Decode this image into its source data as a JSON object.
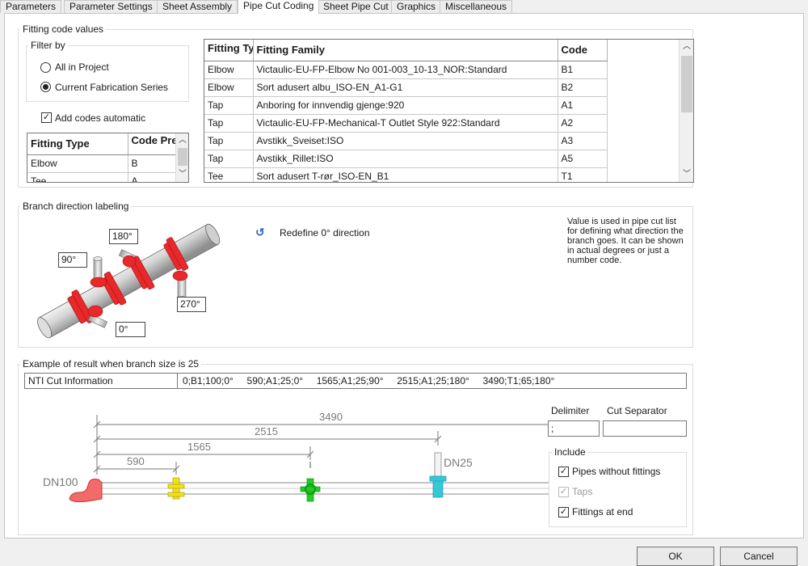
{
  "tabs": [
    "Parameters",
    "Parameter Settings",
    "Sheet Assembly",
    "Pipe Cut Coding",
    "Sheet Pipe Cut",
    "Graphics",
    "Miscellaneous"
  ],
  "active_tab": "Pipe Cut Coding",
  "fitting_codes": {
    "title": "Fitting code values",
    "filter": {
      "title": "Filter by",
      "options": [
        "All in Project",
        "Current Fabrication Series"
      ],
      "selected": "Current Fabrication Series"
    },
    "add_codes_label": "Add codes automatic",
    "add_codes_checked": true,
    "prefix_table": {
      "headers": [
        "Fitting Type",
        "Code Prefix"
      ],
      "rows": [
        [
          "Elbow",
          "B"
        ],
        [
          "Tee",
          "A"
        ]
      ]
    },
    "code_table": {
      "headers": [
        "Fitting Type",
        "Fitting Family",
        "Code"
      ],
      "rows": [
        [
          "Elbow",
          "Victaulic-EU-FP-Elbow No 001-003_10-13_NOR:Standard",
          "B1"
        ],
        [
          "Elbow",
          "Sort adusert albu_ISO-EN_A1-G1",
          "B2"
        ],
        [
          "Tap",
          "Anboring for innvendig gjenge:920",
          "A1"
        ],
        [
          "Tap",
          "Victaulic-EU-FP-Mechanical-T Outlet Style 922:Standard",
          "A2"
        ],
        [
          "Tap",
          "Avstikk_Sveiset:ISO",
          "A3"
        ],
        [
          "Tap",
          "Avstikk_Rillet:ISO",
          "A5"
        ],
        [
          "Tee",
          "Sort adusert T-rør_ISO-EN_B1",
          "T1"
        ]
      ]
    }
  },
  "branch": {
    "title": "Branch direction labeling",
    "degrees": [
      "180°",
      "90°",
      "270°",
      "0°"
    ],
    "redefine_label": "Redefine 0° direction",
    "note": "Value is used in pipe cut list for defining what direction the branch goes. It can be shown in actual degrees or just a number code."
  },
  "example": {
    "title": "Example of result when branch size is 25",
    "field_label": "NTI Cut Information",
    "field_value": "0;B1;100;0°     590;A1;25;0°     1565;A1;25;90°     2515;A1;25;180°     3490;T1;65;180°",
    "dims": [
      "3490",
      "2515",
      "1565",
      "590"
    ],
    "dn_main": "DN100",
    "dn_branch": "DN25",
    "delimiter_label": "Delimiter",
    "delimiter_value": ";",
    "cut_separator_label": "Cut Separator",
    "cut_separator_value": "",
    "include": {
      "title": "Include",
      "items": [
        {
          "label": "Pipes without fittings",
          "checked": true,
          "enabled": true
        },
        {
          "label": "Taps",
          "checked": true,
          "enabled": false
        },
        {
          "label": "Fittings at end",
          "checked": true,
          "enabled": true
        }
      ]
    }
  },
  "buttons": {
    "ok": "OK",
    "cancel": "Cancel"
  },
  "colors": {
    "fitting_red": "#e8282a",
    "tap_yellow": "#f0e020",
    "tap_green": "#22cc22",
    "tap_cyan": "#35c7d8"
  }
}
